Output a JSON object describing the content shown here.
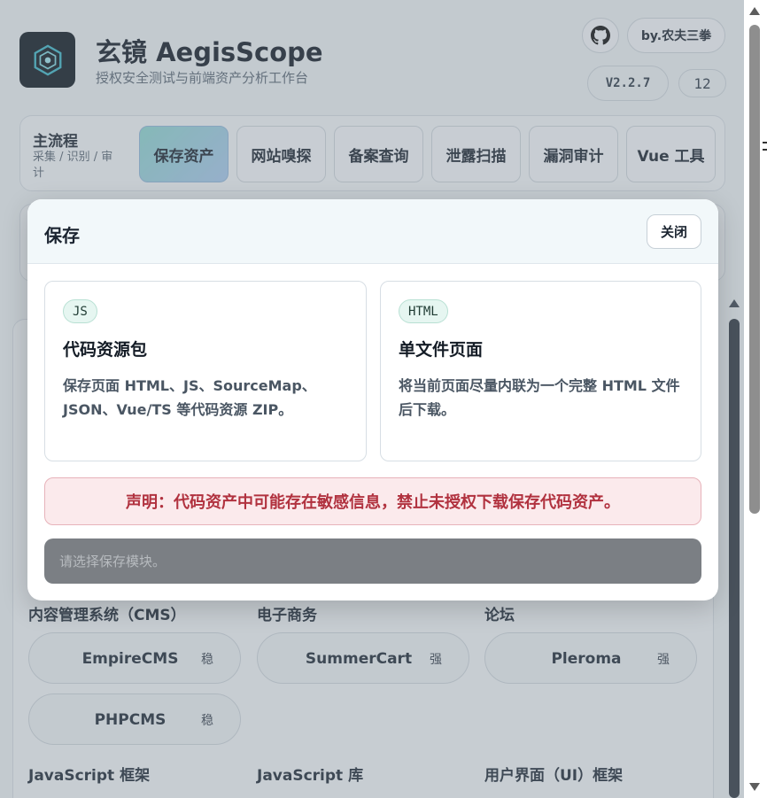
{
  "app": {
    "title": "玄镜 AegisScope",
    "subtitle": "授权安全测试与前端资产分析工作台",
    "author": "by.农夫三拳",
    "version": "V2.2.7",
    "count": "12"
  },
  "flow": {
    "title": "主流程",
    "subtitle": "采集 / 识别 / 审计",
    "tabs": [
      {
        "label": "保存资产",
        "active": true
      },
      {
        "label": "网站嗅探",
        "active": false
      },
      {
        "label": "备案查询",
        "active": false
      },
      {
        "label": "泄露扫描",
        "active": false
      },
      {
        "label": "漏洞审计",
        "active": false
      },
      {
        "label": "Vue 工具",
        "active": false
      }
    ]
  },
  "categories": [
    {
      "label": "内容管理系统（CMS）",
      "items": [
        {
          "name": "EmpireCMS",
          "tag": "稳"
        },
        {
          "name": "PHPCMS",
          "tag": "稳"
        }
      ]
    },
    {
      "label": "电子商务",
      "items": [
        {
          "name": "SummerCart",
          "tag": "强"
        }
      ]
    },
    {
      "label": "论坛",
      "items": [
        {
          "name": "Pleroma",
          "tag": "强"
        }
      ]
    },
    {
      "label": "JavaScript 框架",
      "items": []
    },
    {
      "label": "JavaScript 库",
      "items": []
    },
    {
      "label": "用户界面（UI）框架",
      "items": []
    }
  ],
  "modal": {
    "title": "保存",
    "close_label": "关闭",
    "cards": [
      {
        "badge": "JS",
        "title": "代码资源包",
        "desc": "保存页面 HTML、JS、SourceMap、JSON、Vue/TS 等代码资源 ZIP。"
      },
      {
        "badge": "HTML",
        "title": "单文件页面",
        "desc": "将当前页面尽量内联为一个完整 HTML 文件后下载。"
      }
    ],
    "notice": "声明：代码资产中可能存在敏感信息，禁止未授权下载保存代码资产。",
    "status_placeholder": "请选择保存模块。"
  },
  "colors": {
    "accent": "#8ed7d0",
    "notice_text": "#b1323f",
    "notice_bg": "#fbeaec"
  },
  "icons": {
    "logo": "shield-hex-icon",
    "github": "github-icon"
  }
}
